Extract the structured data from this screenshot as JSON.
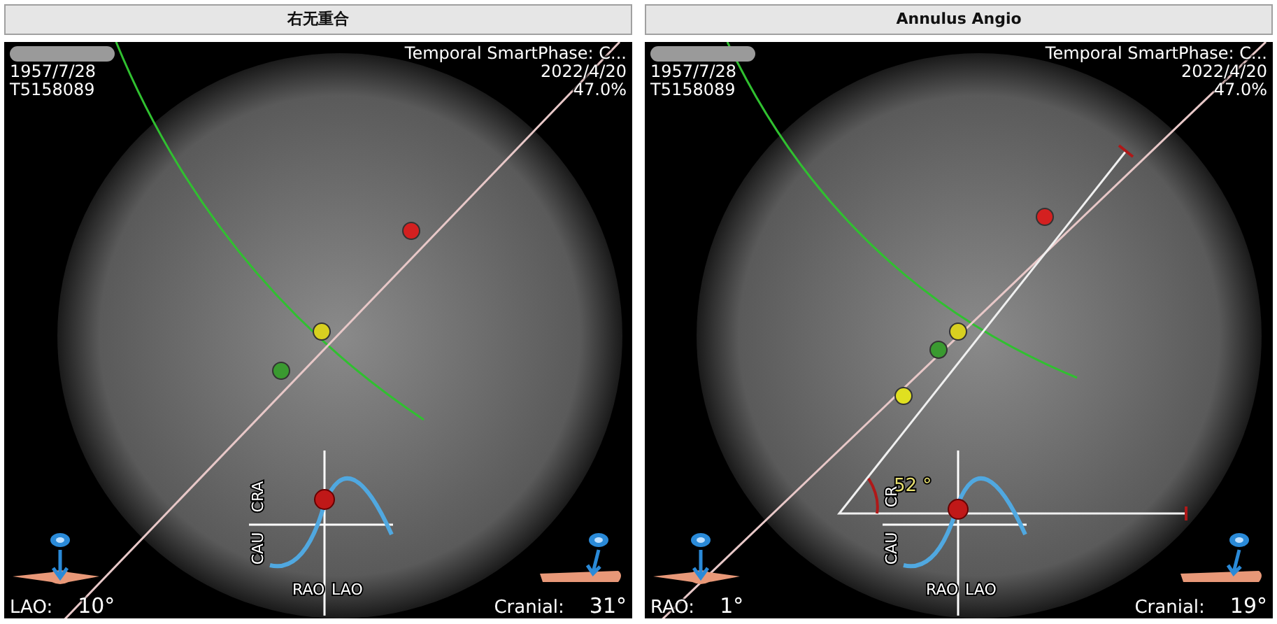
{
  "panels": [
    {
      "title": "右无重合",
      "patient": {
        "dob": "1957/7/28",
        "id": "T5158089"
      },
      "info": {
        "phase": "Temporal SmartPhase: C...",
        "date": "2022/4/20",
        "percent": "47.0%"
      },
      "graph": {
        "cranial_label": "CRA",
        "caudal_label": "CAU",
        "rao_label": "RAO",
        "lao_label": "LAO"
      },
      "left_readout": {
        "label": "LAO:",
        "value": "10°"
      },
      "right_readout": {
        "label": "Cranial:",
        "value": "31°"
      }
    },
    {
      "title": "Annulus Angio",
      "patient": {
        "dob": "1957/7/28",
        "id": "T5158089"
      },
      "info": {
        "phase": "Temporal SmartPhase: C...",
        "date": "2022/4/20",
        "percent": "47.0%"
      },
      "graph": {
        "cranial_label": "CR",
        "caudal_label": "CAU",
        "rao_label": "RAO",
        "lao_label": "LAO"
      },
      "angle_label": "52 °",
      "left_readout": {
        "label": "RAO:",
        "value": "1°"
      },
      "right_readout": {
        "label": "Cranial:",
        "value": "19°"
      }
    }
  ]
}
